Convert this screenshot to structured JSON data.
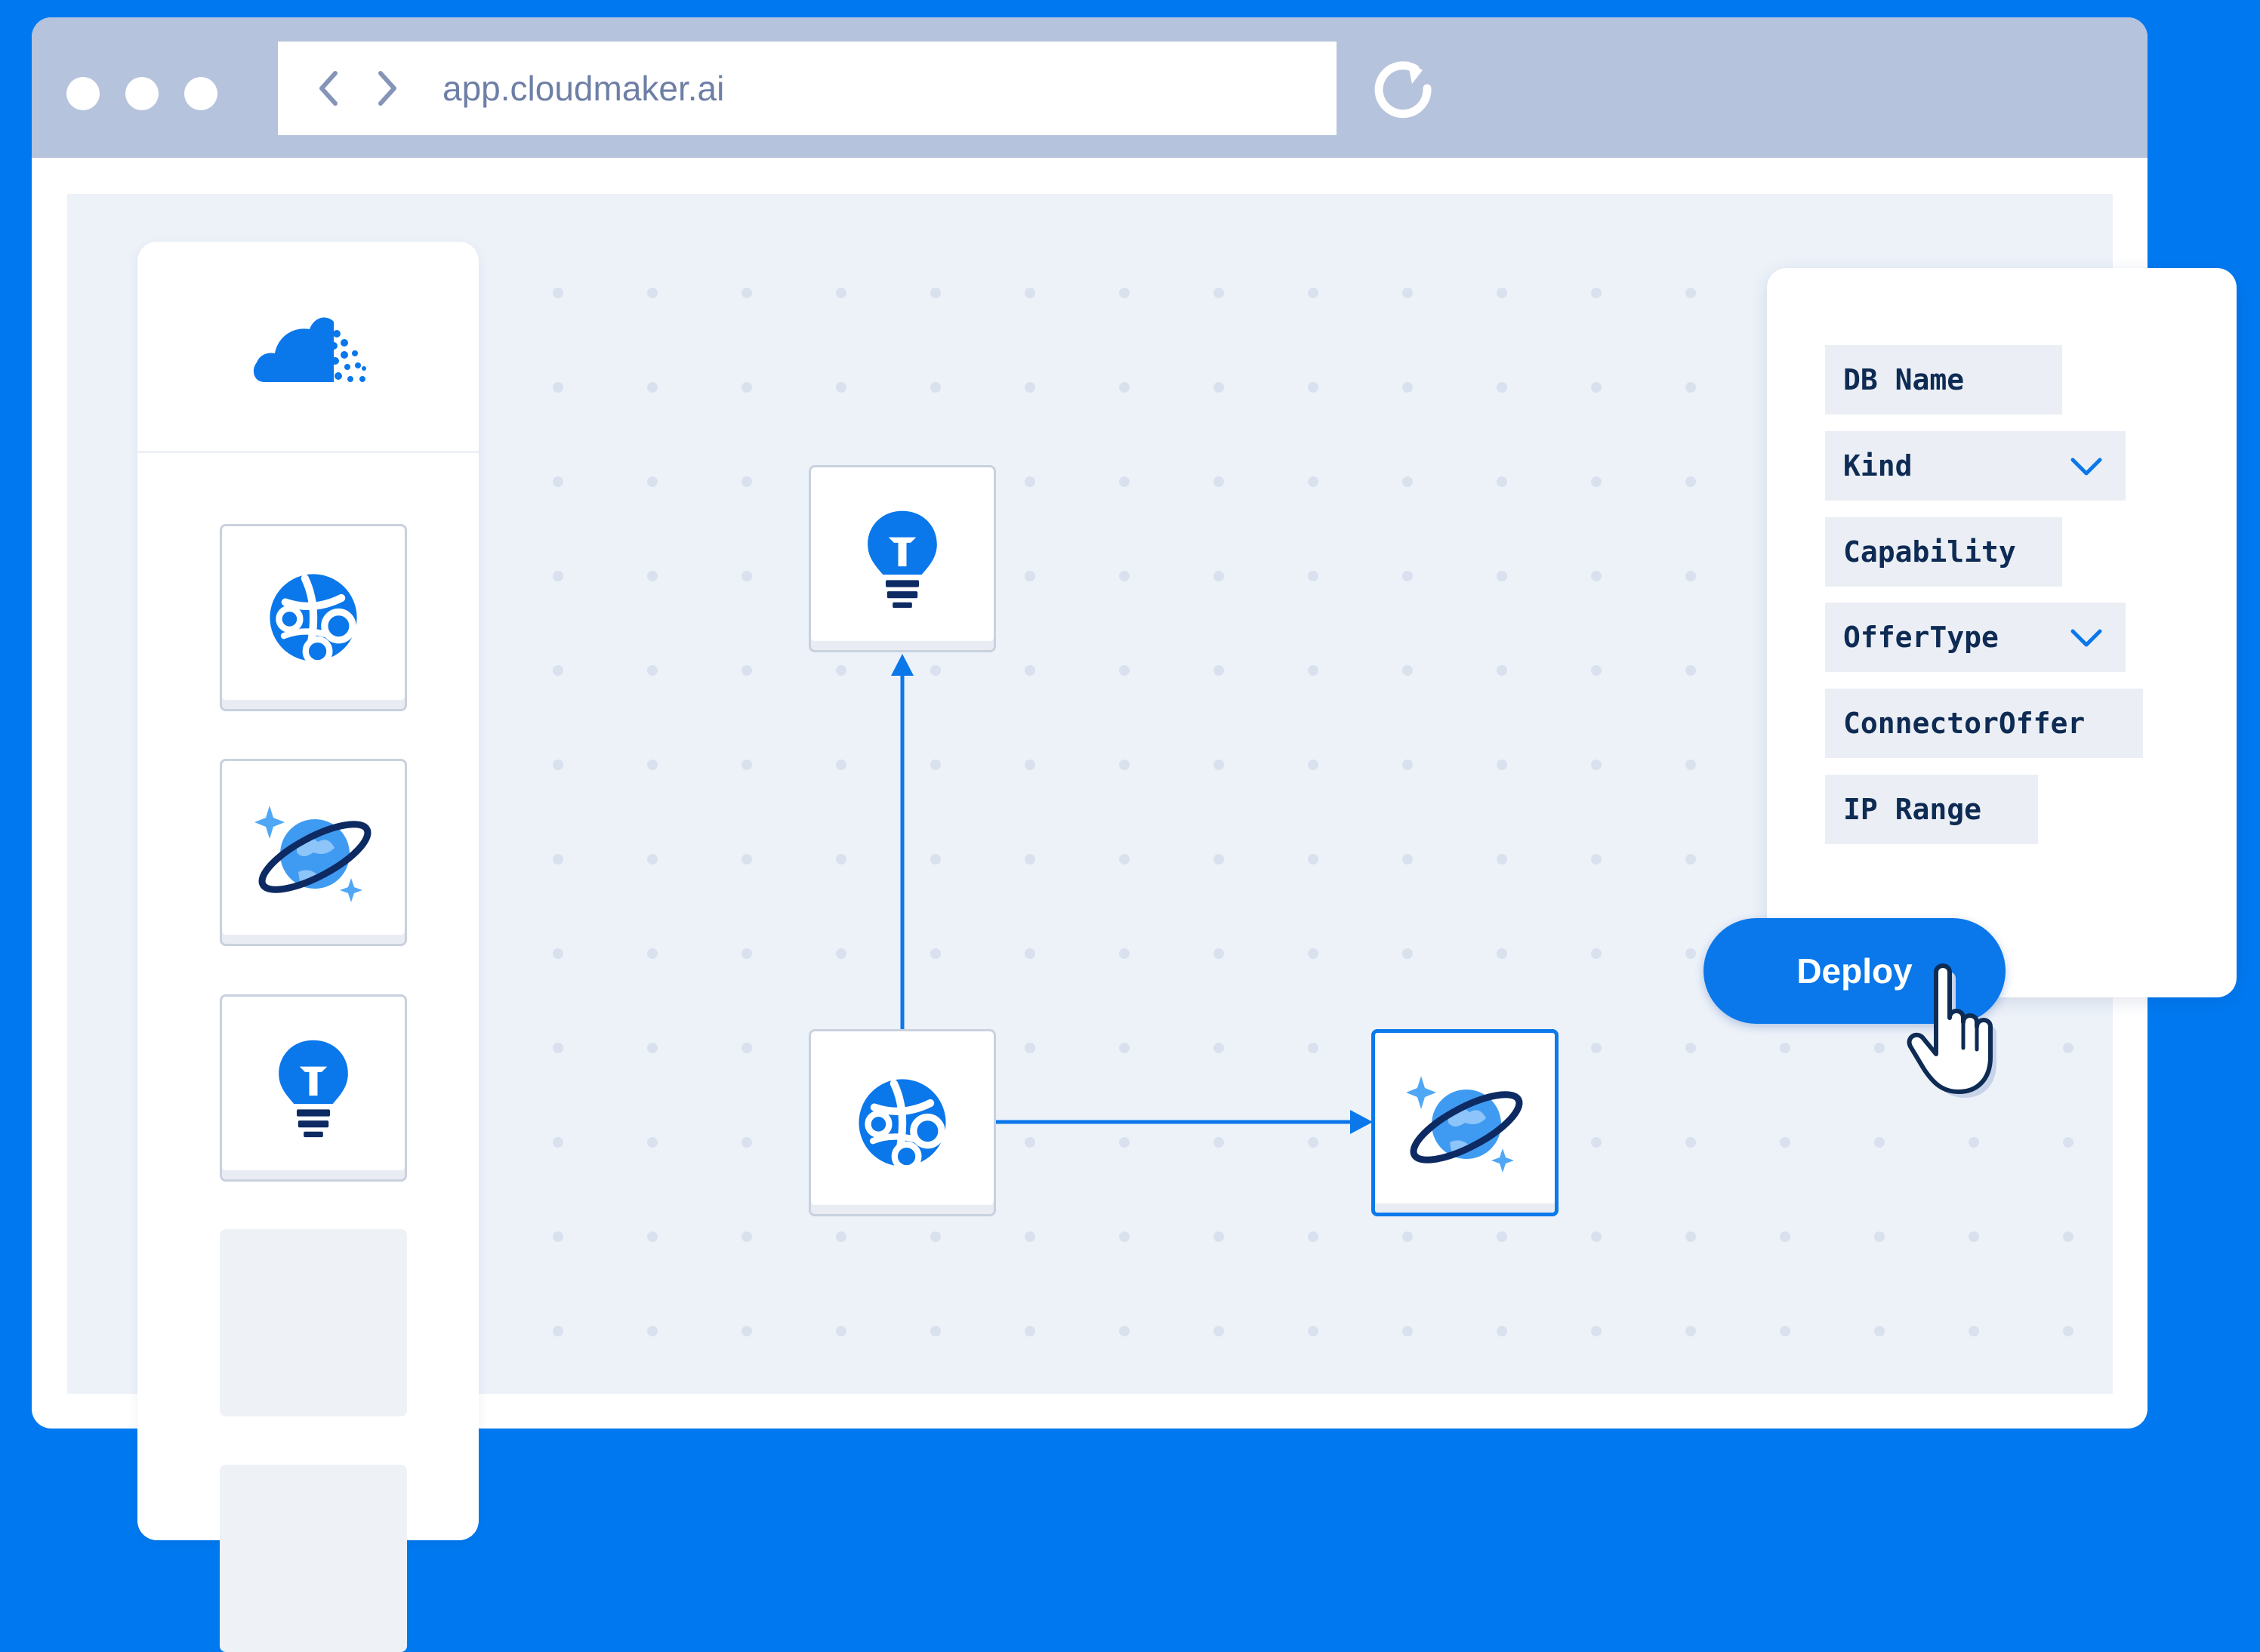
{
  "browser": {
    "url": "app.cloudmaker.ai"
  },
  "palette": {
    "background": "#0079F0",
    "accent": "#0A77EA",
    "titlebar": "#B6C3DC",
    "canvas": "#EDF2F9",
    "field_text": "#0E2B54"
  },
  "sidebar": {
    "logo": "cloudmaker-logo",
    "tiles": [
      {
        "icon": "app-service-globe-icon"
      },
      {
        "icon": "cosmos-db-planet-icon"
      },
      {
        "icon": "app-insights-bulb-icon"
      },
      {
        "icon": "empty"
      },
      {
        "icon": "empty"
      }
    ]
  },
  "diagram": {
    "nodes": [
      {
        "id": "insights",
        "icon": "app-insights-bulb-icon"
      },
      {
        "id": "app-service",
        "icon": "app-service-globe-icon"
      },
      {
        "id": "cosmos-db",
        "icon": "cosmos-db-planet-icon",
        "selected": true
      }
    ],
    "edges": [
      {
        "from": "app-service",
        "to": "insights"
      },
      {
        "from": "app-service",
        "to": "cosmos-db"
      }
    ]
  },
  "properties": {
    "fields": [
      {
        "label": "DB Name",
        "dropdown": false
      },
      {
        "label": "Kind",
        "dropdown": true
      },
      {
        "label": "Capability",
        "dropdown": false
      },
      {
        "label": "OfferType",
        "dropdown": true
      },
      {
        "label": "ConnectorOffer",
        "dropdown": false
      },
      {
        "label": "IP Range",
        "dropdown": false
      }
    ]
  },
  "actions": {
    "deploy_label": "Deploy"
  }
}
